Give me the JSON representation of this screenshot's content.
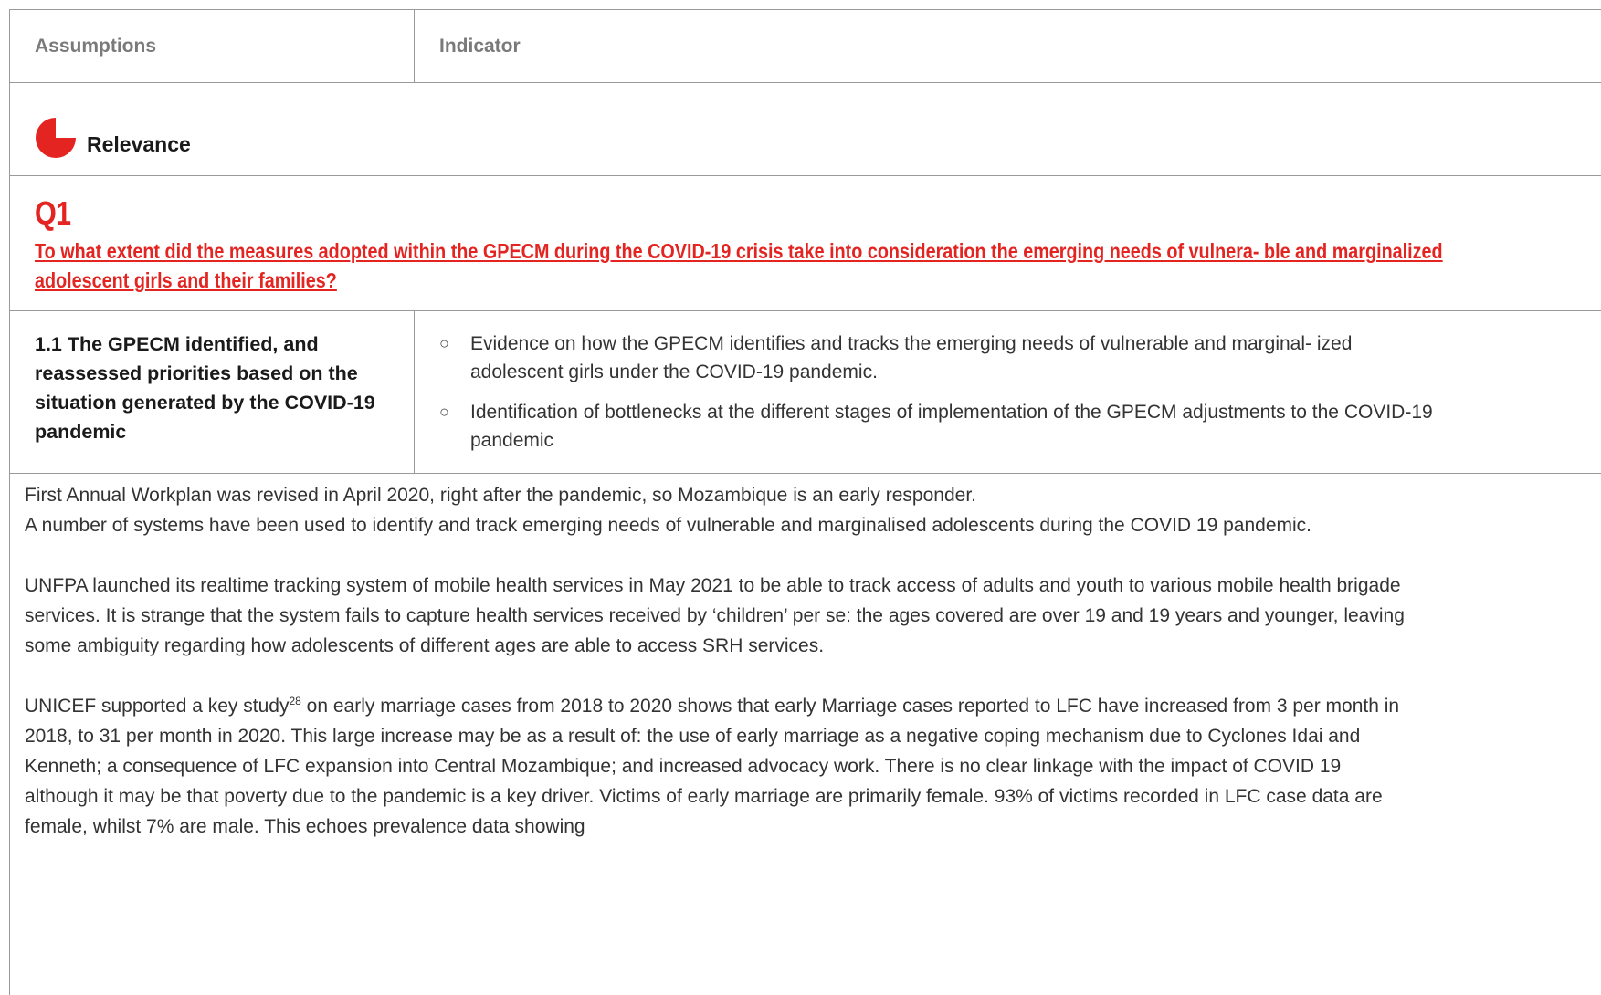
{
  "header": {
    "col_assumptions": "Assumptions",
    "col_indicator": "Indicator"
  },
  "section": {
    "icon": "pie-chart-quarter-icon",
    "title": "Relevance",
    "accent_color": "#e42421"
  },
  "question": {
    "number": "Q1",
    "text": "To what extent did the measures adopted within the GPECM during the COVID-19 crisis take into consideration the emerging needs of vulnera- ble and marginalized adolescent girls and their families?"
  },
  "assumption": {
    "text": "1.1 The GPECM identified, and reassessed priorities based on the situation generated by the COVID-19 pandemic"
  },
  "indicators": [
    "Evidence on how the GPECM identifies and tracks the emerging needs of vulnerable and marginal- ized adolescent girls under the COVID-19 pandemic.",
    "Identification of bottlenecks at the different stages of implementation of the GPECM adjustments to the COVID-19 pandemic"
  ],
  "bullet_glyph": "○",
  "body": {
    "p1_line1": "First Annual Workplan was revised in April 2020, right after the pandemic, so Mozambique is an early responder.",
    "p1_line2": "A number of systems have been used to identify and track emerging needs of vulnerable and marginalised adolescents during the COVID 19 pandemic.",
    "p2": "UNFPA launched its realtime tracking system of mobile health services in May 2021 to be able to track access of adults and youth to various mobile health brigade services. It is strange that the system fails to capture health services received by ‘children’ per se: the ages covered are over 19 and 19 years and younger, leaving some ambiguity regarding how adolescents of different ages are able to access SRH services.",
    "p3_before": "UNICEF supported a key study",
    "p3_footnote": "28",
    "p3_after": " on early marriage cases from 2018 to 2020 shows that early Marriage cases reported to LFC have increased from 3 per month in 2018, to 31 per month in 2020. This large increase may be as a result of: the use of early marriage as a negative coping mechanism due to Cyclones Idai and Kenneth; a consequence of LFC expansion into Central Mozambique; and increased advocacy work. There is no clear linkage with the impact of COVID 19 although it may be that poverty due to the pandemic is a key driver. Victims of early marriage are primarily female. 93% of victims recorded in LFC case data are female, whilst 7% are male. This echoes prevalence data showing"
  }
}
